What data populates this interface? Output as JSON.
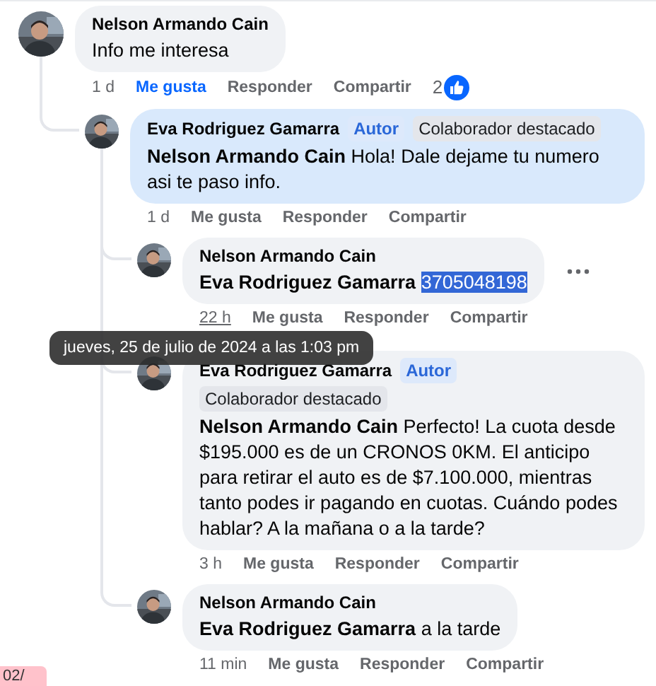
{
  "comments": [
    {
      "author": "Nelson Armando Cain",
      "segments": [
        {
          "kind": "plain",
          "text": "Info me interesa"
        }
      ],
      "highlighted": false,
      "more_button": false,
      "time": "1 d",
      "time_hovered": false,
      "liked": true,
      "actions": [
        "Me gusta",
        "Responder",
        "Compartir"
      ],
      "reaction_count": "2",
      "children": [
        {
          "author": "Eva Rodriguez Gamarra",
          "badges": [
            {
              "kind": "author",
              "text": "Autor"
            },
            {
              "kind": "top_contributor",
              "text": "Colaborador destacado"
            }
          ],
          "segments": [
            {
              "kind": "mention",
              "text": "Nelson Armando Cain"
            },
            {
              "kind": "plain",
              "text": "Hola! Dale dejame tu numero asi te paso info."
            }
          ],
          "highlighted": true,
          "more_button": false,
          "time": "1 d",
          "time_hovered": false,
          "liked": false,
          "actions": [
            "Me gusta",
            "Responder",
            "Compartir"
          ],
          "children": [
            {
              "author": "Nelson Armando Cain",
              "segments": [
                {
                  "kind": "mention",
                  "text": "Eva Rodriguez Gamarra"
                },
                {
                  "kind": "selected",
                  "text": "3705048198"
                }
              ],
              "highlighted": false,
              "more_button": true,
              "time": "22 h",
              "time_hovered": true,
              "liked": false,
              "actions": [
                "Me gusta",
                "Responder",
                "Compartir"
              ]
            },
            {
              "author": "Eva Rodriguez Gamarra",
              "badges": [
                {
                  "kind": "author",
                  "text": "Autor"
                },
                {
                  "kind": "top_contributor",
                  "text": "Colaborador destacado"
                }
              ],
              "segments": [
                {
                  "kind": "mention",
                  "text": "Nelson Armando Cain"
                },
                {
                  "kind": "plain",
                  "text": "Perfecto! La cuota desde $195.000 es de un CRONOS 0KM. El anticipo para retirar el auto es de $7.100.000, mientras tanto podes ir pagando en cuotas. Cuándo podes hablar? A la mañana o a la tarde?"
                }
              ],
              "highlighted": false,
              "more_button": false,
              "time": "3 h",
              "time_hovered": false,
              "liked": false,
              "actions": [
                "Me gusta",
                "Responder",
                "Compartir"
              ]
            },
            {
              "author": "Nelson Armando Cain",
              "segments": [
                {
                  "kind": "mention",
                  "text": "Eva Rodriguez Gamarra"
                },
                {
                  "kind": "plain",
                  "text": "a la tarde"
                }
              ],
              "highlighted": false,
              "more_button": false,
              "time": "11 min",
              "time_hovered": false,
              "liked": false,
              "actions": [
                "Me gusta",
                "Responder",
                "Compartir"
              ]
            }
          ]
        }
      ]
    }
  ],
  "tooltip": {
    "text": "jueves, 25 de julio de 2024 a las 1:03 pm"
  },
  "edge_fragment": {
    "text": "02/"
  }
}
